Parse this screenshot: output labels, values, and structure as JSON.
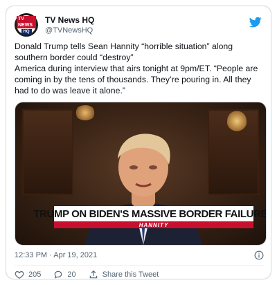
{
  "account": {
    "name": "TV News HQ",
    "handle": "@TVNewsHQ",
    "logo_top": "TV NEWS",
    "logo_bottom": "HQ"
  },
  "tweet": {
    "text": "Donald Trump tells Sean Hannity “horrible situation” along southern border could “destroy”\nAmerica during interview that airs tonight at 9pm/ET. “People are coming in by the tens of thousands. They’re pouring in. All they had to do was leave it alone.”"
  },
  "media": {
    "chyron": "TRUMP ON BIDEN'S MASSIVE BORDER FAILURES",
    "show_name": "HANNITY"
  },
  "meta": {
    "timestamp": "12:33 PM · Apr 19, 2021"
  },
  "actions": {
    "likes": "205",
    "replies": "20",
    "share_label": "Share this Tweet"
  },
  "icons": {
    "bird": "twitter-bird-icon",
    "info": "info-icon",
    "heart": "heart-icon",
    "reply": "reply-icon",
    "share": "share-icon"
  },
  "colors": {
    "twitter_blue": "#1d9bf0",
    "secondary_text": "#536471",
    "chyron_red": "#c8102e"
  }
}
